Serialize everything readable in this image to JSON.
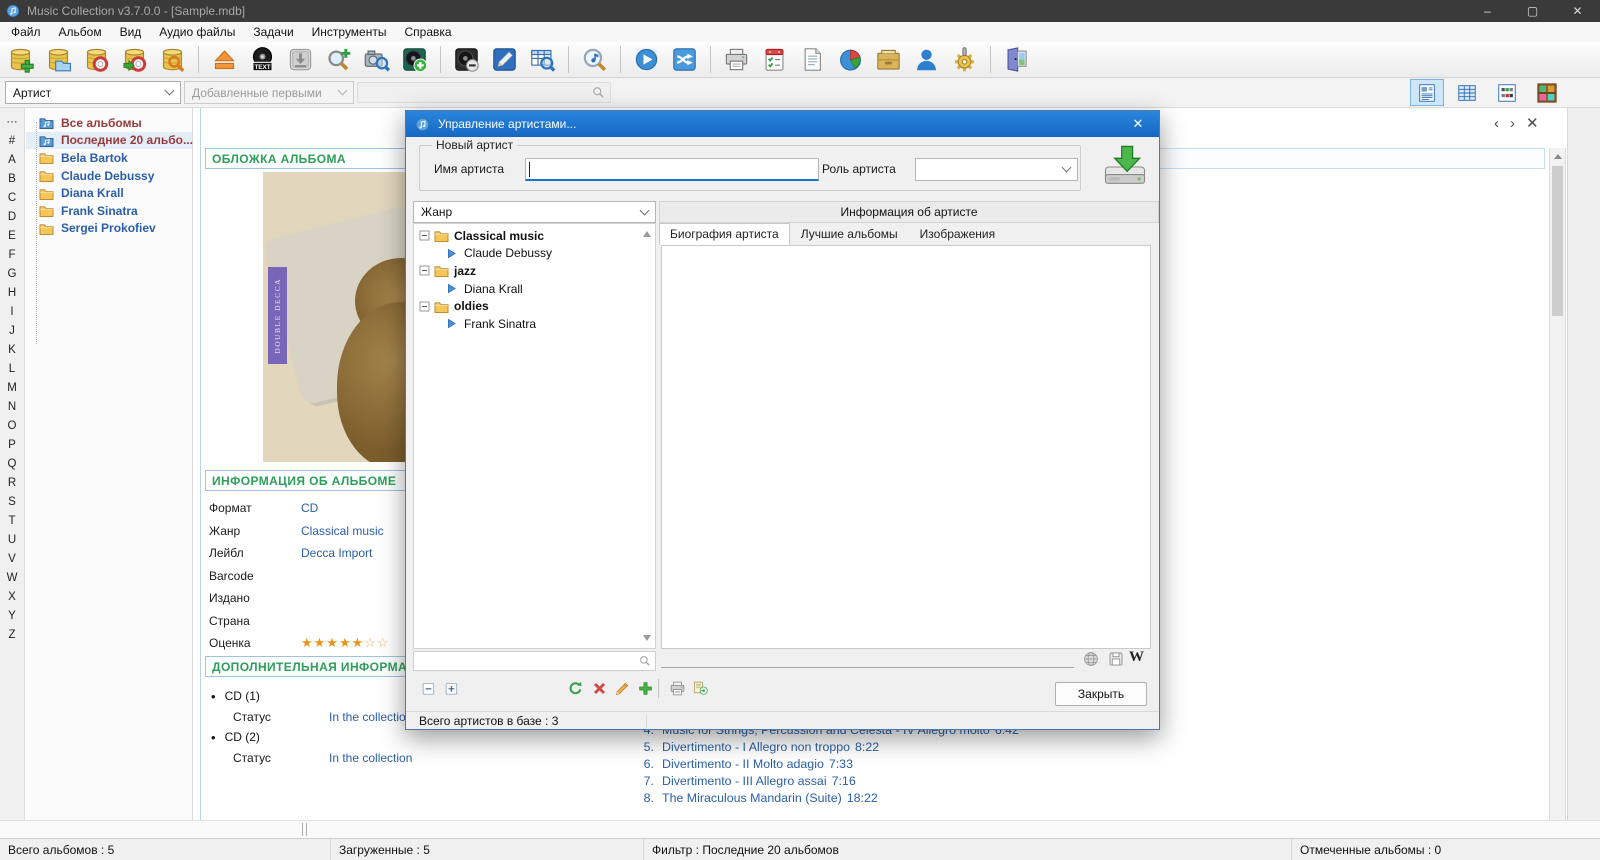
{
  "colors": {
    "accent": "#1576d2",
    "header_green": "#2e9e5b",
    "link_blue": "#2a5fa8",
    "special_red": "#9a3b3b",
    "star_orange": "#e8941a",
    "dialog_title_blue": "#1a74cf"
  },
  "window": {
    "title": "Music Collection v3.7.0.0 - [Sample.mdb]",
    "minimize": "–",
    "maximize": "▢",
    "close": "✕"
  },
  "menu": [
    "Файл",
    "Альбом",
    "Вид",
    "Аудио файлы",
    "Задачи",
    "Инструменты",
    "Справка"
  ],
  "toolbar": {
    "cd_text_label": "TEXT",
    "items": [
      "new-database",
      "open-database",
      "backup-database",
      "restore-database",
      "repair-database",
      "|",
      "eject-disc",
      "cd-text",
      "download-info",
      "find-new",
      "find-cover",
      "add-album",
      "|",
      "remove-album",
      "edit-album",
      "browse-albums",
      "|",
      "find-audio",
      "|",
      "play",
      "random-play",
      "|",
      "print",
      "tasks",
      "report",
      "statistics",
      "card-file",
      "artists",
      "tools",
      "|",
      "exit"
    ]
  },
  "filter_bar": {
    "group_value": "Артист",
    "sort_value": "Добавленные первыми",
    "search_value": ""
  },
  "view_buttons": [
    "details-view",
    "table-view",
    "thumbnails-view",
    "shelf-view"
  ],
  "alphabet": [
    "···",
    "#",
    "A",
    "B",
    "C",
    "D",
    "E",
    "F",
    "G",
    "H",
    "I",
    "J",
    "K",
    "L",
    "M",
    "N",
    "O",
    "P",
    "Q",
    "R",
    "S",
    "T",
    "U",
    "V",
    "W",
    "X",
    "Y",
    "Z"
  ],
  "sidebar": {
    "items": [
      {
        "label": "Все альбомы",
        "special": true
      },
      {
        "label": "Последние 20 альбо...",
        "special": true,
        "selected": true
      },
      {
        "label": "Bela Bartok"
      },
      {
        "label": "Claude Debussy"
      },
      {
        "label": "Diana Krall"
      },
      {
        "label": "Frank Sinatra"
      },
      {
        "label": "Sergei Prokofiev"
      }
    ]
  },
  "album_panel": {
    "cover_header": "ОБЛОЖКА АЛЬБОМА",
    "cover_text": "Double Decca",
    "info_header": "ИНФОРМАЦИЯ ОБ АЛЬБОМЕ",
    "fields": [
      {
        "label": "Формат",
        "value": "CD"
      },
      {
        "label": "Жанр",
        "value": "Classical music"
      },
      {
        "label": "Лейбл",
        "value": "Decca Import"
      },
      {
        "label": "Barcode",
        "value": ""
      },
      {
        "label": "Издано",
        "value": ""
      },
      {
        "label": "Страна",
        "value": ""
      }
    ],
    "rating_label": "Оценка",
    "rating_filled": 5,
    "rating_empty": 2,
    "extra_header": "ДОПОЛНИТЕЛЬНАЯ ИНФОРМАЦИЯ",
    "discs": [
      {
        "name": "CD (1)",
        "status_label": "Статус",
        "status": "In the collection"
      },
      {
        "name": "CD (2)",
        "status_label": "Статус",
        "status": "In the collection"
      }
    ]
  },
  "main_view": {
    "nav_back": "‹",
    "nav_forward": "›",
    "nav_close": "✕",
    "tracks": [
      {
        "num": "4.",
        "title": "Music for Strings, Percussion and Celesta - IV Allegro molto",
        "time": "6:42"
      },
      {
        "num": "5.",
        "title": "Divertimento - I Allegro non troppo",
        "time": "8:22"
      },
      {
        "num": "6.",
        "title": "Divertimento - II Molto adagio",
        "time": "7:33"
      },
      {
        "num": "7.",
        "title": "Divertimento - III Allegro assai",
        "time": "7:16"
      },
      {
        "num": "8.",
        "title": "The Miraculous Mandarin (Suite)",
        "time": "18:22"
      }
    ]
  },
  "dialog": {
    "title": "Управление артистами...",
    "close_glyph": "✕",
    "group_label": "Новый артист",
    "name_label": "Имя артиста",
    "name_value": "",
    "role_label": "Роль артиста",
    "role_value": "",
    "genre_combo_value": "Жанр",
    "tree": [
      {
        "label": "Classical music",
        "genre": true
      },
      {
        "label": "Claude Debussy"
      },
      {
        "label": "jazz",
        "genre": true
      },
      {
        "label": "Diana Krall"
      },
      {
        "label": "oldies",
        "genre": true
      },
      {
        "label": "Frank Sinatra"
      }
    ],
    "info_header": "Информация об артисте",
    "tabs": [
      {
        "label": "Биография артиста",
        "active": true
      },
      {
        "label": "Лучшие альбомы"
      },
      {
        "label": "Изображения"
      }
    ],
    "bio_value": "",
    "wikipedia_label": "W",
    "close_button": "Закрыть",
    "status": "Всего артистов в базе : 3"
  },
  "status_bar": [
    "Всего альбомов : 5",
    "Загруженные : 5",
    "Фильтр : Последние 20 альбомов",
    "Отмеченные альбомы : 0"
  ]
}
